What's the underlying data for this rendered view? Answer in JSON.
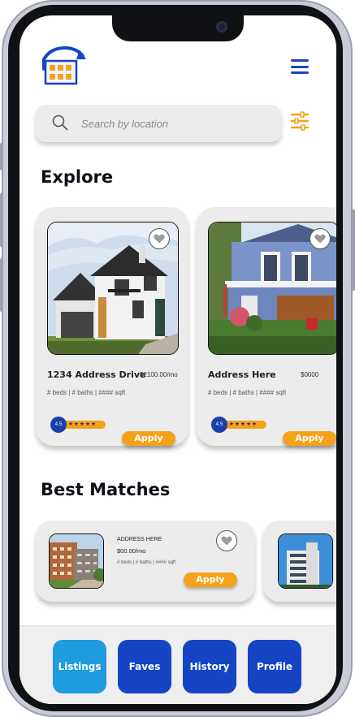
{
  "colors": {
    "primary_blue": "#1545c4",
    "accent_orange": "#f5a21b",
    "nav_active": "#1f9be0",
    "nav_default": "#1545c4"
  },
  "header": {
    "logo_icon": "house-refresh-logo",
    "menu_icon": "hamburger-menu-icon"
  },
  "search": {
    "placeholder": "Search by location",
    "icon": "search-icon",
    "filter_icon": "sliders-icon"
  },
  "explore": {
    "title": "Explore",
    "cards": [
      {
        "address": "1234 Address Drive",
        "price": "$2100.00/mo",
        "meta": "# beds | # baths | #### sqft",
        "rating": "4.5",
        "stars": 4.5,
        "apply_label": "Apply"
      },
      {
        "address": "Address Here",
        "price": "$0000",
        "meta": "# beds | # baths | #### sqft",
        "rating": "4.5",
        "stars": 5,
        "apply_label": "Apply"
      }
    ]
  },
  "best_matches": {
    "title": "Best Matches",
    "cards": [
      {
        "address": "ADDRESS HERE",
        "price": "$00.00/mo",
        "meta": "# beds | # baths | #### sqft",
        "apply_label": "Apply"
      }
    ]
  },
  "nav": {
    "items": [
      {
        "label": "Listings",
        "active": true
      },
      {
        "label": "Faves",
        "active": false
      },
      {
        "label": "History",
        "active": false
      },
      {
        "label": "Profile",
        "active": false
      }
    ]
  }
}
